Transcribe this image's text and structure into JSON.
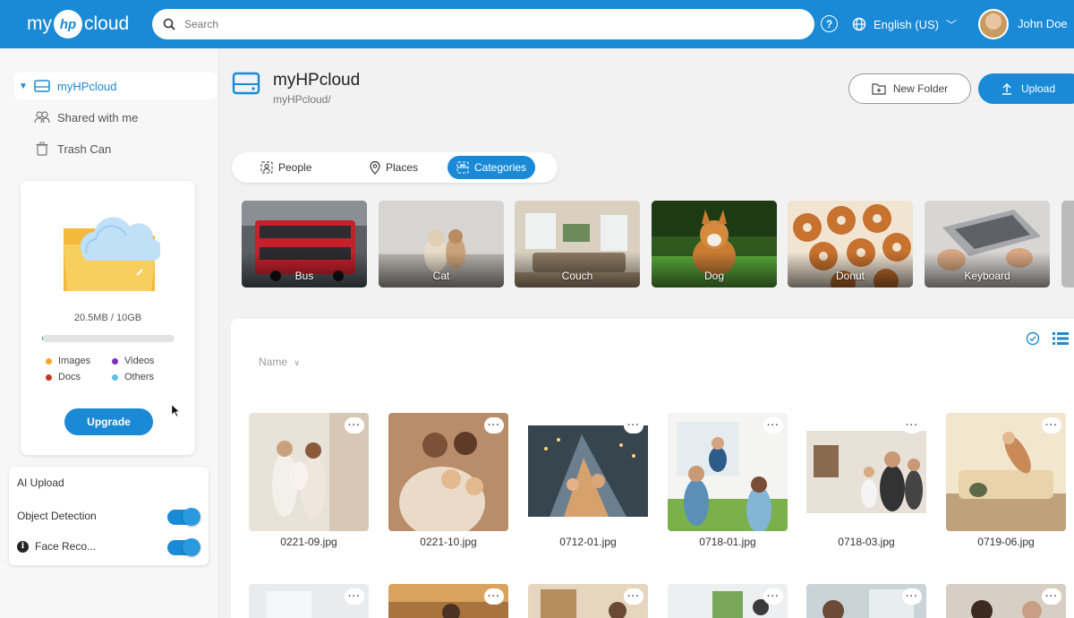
{
  "header": {
    "logo_prefix": "my",
    "logo_mark": "hp",
    "logo_suffix": "cloud",
    "search_placeholder": "Search",
    "language": "English (US)",
    "user_name": "John Doe"
  },
  "sidebar": {
    "items": [
      {
        "label": "myHPcloud",
        "icon": "drive-icon",
        "active": true
      },
      {
        "label": "Shared with me",
        "icon": "people-icon",
        "active": false
      },
      {
        "label": "Trash Can",
        "icon": "trash-icon",
        "active": false
      }
    ],
    "storage": {
      "text": "20.5MB / 10GB",
      "used_fraction": 0.002
    },
    "legend": [
      {
        "label": "Images",
        "color": "#f5a623"
      },
      {
        "label": "Videos",
        "color": "#7b2fbe"
      },
      {
        "label": "Docs",
        "color": "#c0392b"
      },
      {
        "label": "Others",
        "color": "#5bc0eb"
      }
    ],
    "upgrade_label": "Upgrade",
    "ai": {
      "title": "AI Upload",
      "object_detection": "Object Detection",
      "face_recognition": "Face Reco...",
      "object_detection_on": true,
      "face_recognition_on": true
    }
  },
  "main": {
    "title": "myHPcloud",
    "path": "myHPcloud/",
    "new_folder_label": "New Folder",
    "upload_label": "Upload",
    "tabs": [
      {
        "label": "People",
        "icon": "person-icon",
        "active": false
      },
      {
        "label": "Places",
        "icon": "pin-icon",
        "active": false
      },
      {
        "label": "Categories",
        "icon": "category-icon",
        "active": true
      }
    ],
    "categories": [
      "Bus",
      "Cat",
      "Couch",
      "Dog",
      "Donut",
      "Keyboard"
    ],
    "sort_label": "Name",
    "files": [
      "0221-09.jpg",
      "0221-10.jpg",
      "0712-01.jpg",
      "0718-01.jpg",
      "0718-03.jpg",
      "0719-06.jpg"
    ],
    "more_label": "···"
  },
  "colors": {
    "brand": "#1a8ad6",
    "background": "#f2f2f2"
  }
}
